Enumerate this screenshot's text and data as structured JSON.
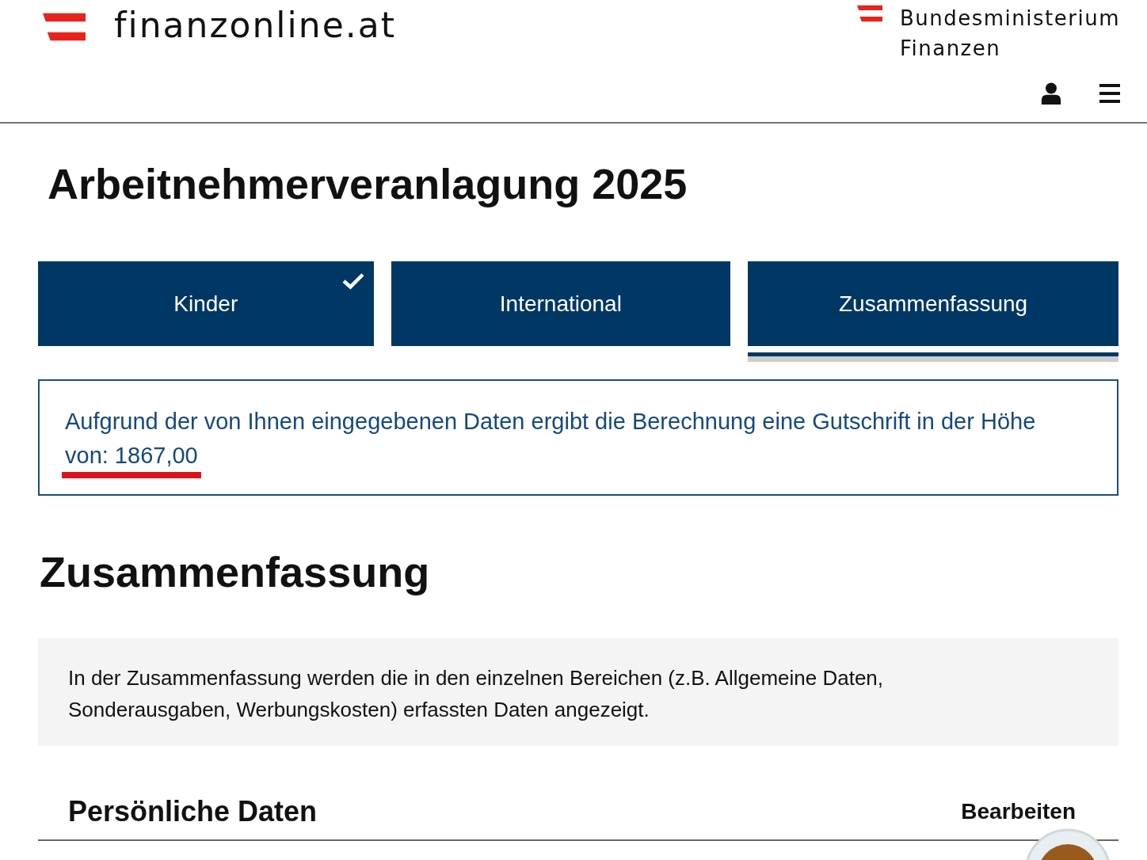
{
  "header": {
    "site_name": "finanzonline.at",
    "ministry_lines": [
      "Bundesministerium",
      "Finanzen"
    ]
  },
  "page_title": "Arbeitnehmerveranlagung 2025",
  "tabs": [
    {
      "label": "Kinder",
      "completed": true,
      "selected": false
    },
    {
      "label": "International",
      "completed": false,
      "selected": false
    },
    {
      "label": "Zusammenfassung",
      "completed": false,
      "selected": true
    }
  ],
  "result_message": {
    "text": "Aufgrund der von Ihnen eingegebenen Daten ergibt die Berechnung eine Gutschrift in der Höhe",
    "amount": "von: 1867,00",
    "amount_underlined": true
  },
  "section_title": "Zusammenfassung",
  "info_text": "In der Zusammenfassung werden die in den einzelnen Bereichen (z.B. Allgemeine Daten, Sonderausgaben, Werbungskosten) erfassten Daten angezeigt.",
  "subsection": {
    "title": "Persönliche Daten",
    "action": "Bearbeiten"
  }
}
